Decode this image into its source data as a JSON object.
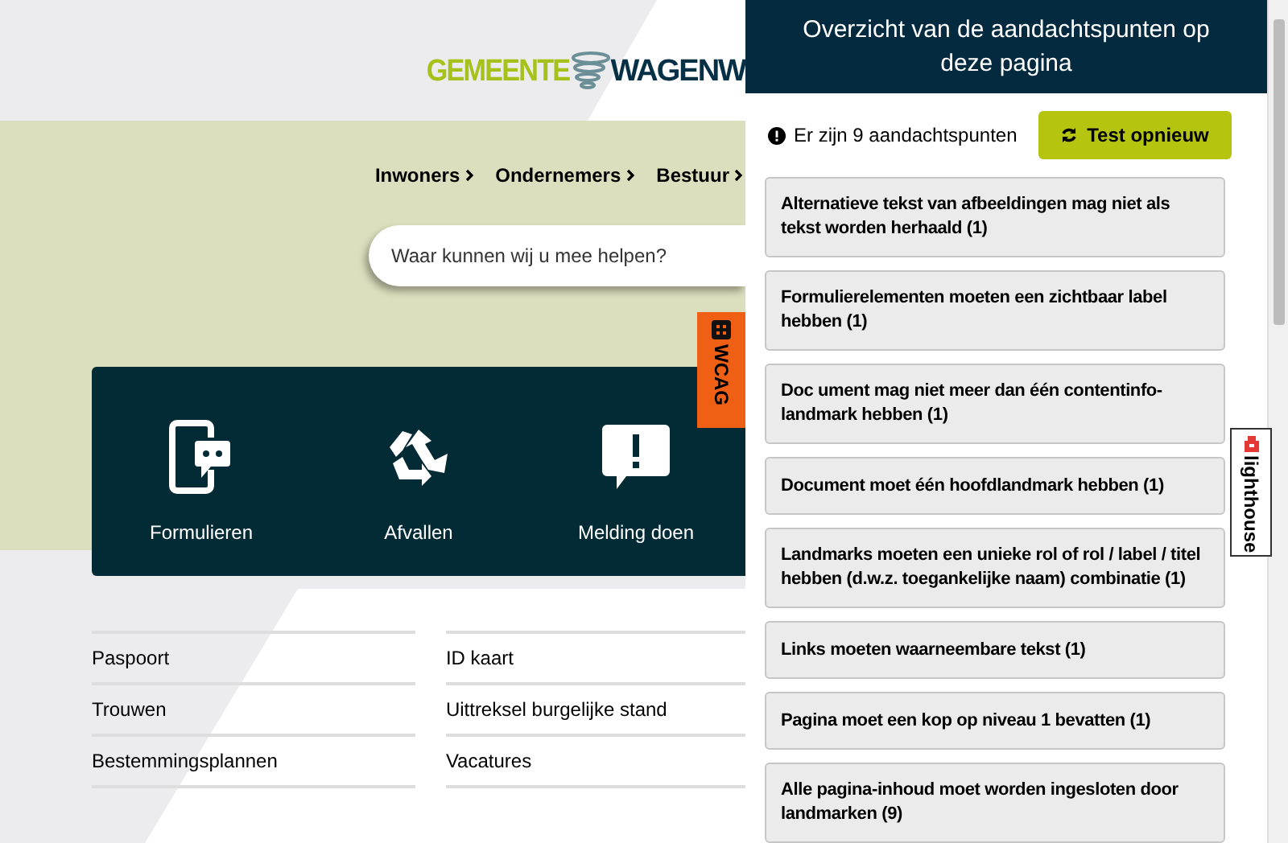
{
  "logo": {
    "part_1": "GEMEENTE",
    "part_2": "WAGENW"
  },
  "nav": [
    "Inwoners",
    "Ondernemers",
    "Bestuur"
  ],
  "search": {
    "placeholder": "Waar kunnen wij u mee helpen?"
  },
  "wcag_tab": {
    "label": "WCAG"
  },
  "tiles": [
    {
      "kind": "form",
      "label": "Formulieren"
    },
    {
      "kind": "recycle",
      "label": "Afvallen"
    },
    {
      "kind": "report",
      "label": "Melding doen"
    }
  ],
  "links": [
    [
      "Paspoort",
      "Trouwen",
      "Bestemmingsplannen"
    ],
    [
      "ID kaart",
      "Uittreksel burgelijke stand",
      "Vacatures"
    ]
  ],
  "panel": {
    "title": "Overzicht van de aandachtspunten op deze pagina",
    "summary": "Er zijn 9 aandachtspunten",
    "retest_button": "Test opnieuw",
    "issues": [
      "Alternatieve tekst van afbeeldingen mag niet als tekst worden herhaald (1)",
      "Formulierelementen moeten een zichtbaar label hebben (1)",
      "Doc ument mag niet meer dan één contentinfo-landmark hebben (1)",
      "Document moet één hoofdlandmark hebben (1)",
      "Landmarks moeten een unieke rol of rol / label / titel hebben (d.w.z. toegankelijke naam) combinatie (1)",
      "Links moeten waarneembare tekst (1)",
      "Pagina moet een kop op niveau 1 bevatten (1)",
      "Alle pagina-inhoud moet worden ingesloten door landmarken (9)"
    ]
  },
  "lighthouse_tab": {
    "label": "lighthouse"
  }
}
